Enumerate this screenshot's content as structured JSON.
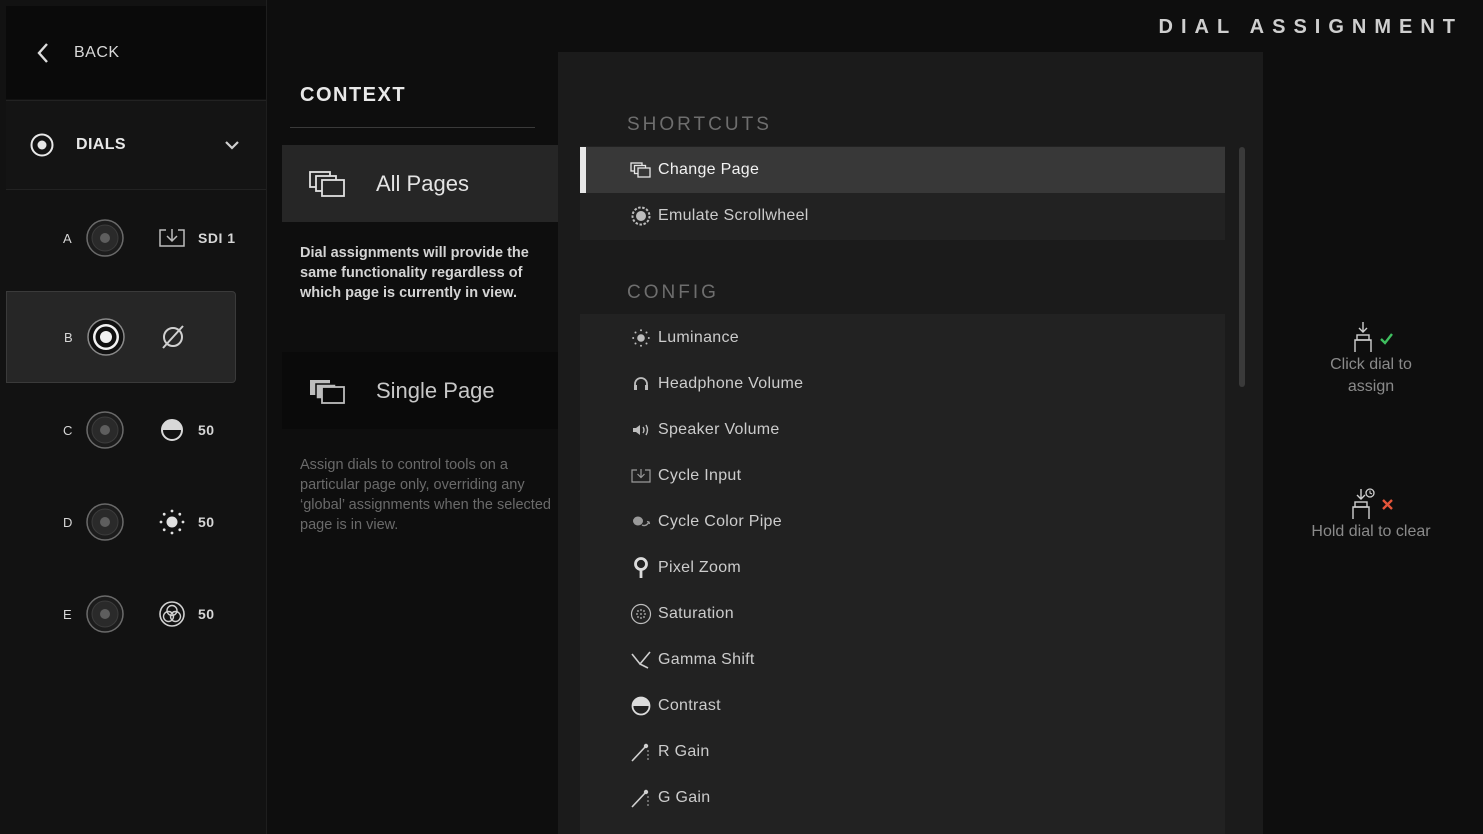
{
  "header": {
    "title": "DIAL ASSIGNMENT"
  },
  "sidebar": {
    "back_label": "BACK",
    "section_label": "DIALS",
    "dials": [
      {
        "letter": "A",
        "icon": "sdi-input-icon",
        "value": "SDI 1",
        "selected": false
      },
      {
        "letter": "B",
        "icon": "unassigned-icon",
        "value": "",
        "selected": true
      },
      {
        "letter": "C",
        "icon": "contrast-icon",
        "value": "50",
        "selected": false
      },
      {
        "letter": "D",
        "icon": "luminance-icon",
        "value": "50",
        "selected": false
      },
      {
        "letter": "E",
        "icon": "saturation-rgb-icon",
        "value": "50",
        "selected": false
      }
    ]
  },
  "context": {
    "heading": "CONTEXT",
    "all_pages": {
      "label": "All Pages",
      "description": "Dial assignments will provide the same functionality regardless of which page is currently in view."
    },
    "single_page": {
      "label": "Single Page",
      "description": "Assign dials to control tools on a particular page only, overriding any ‘global’ assignments when the selected page is in view."
    },
    "selected": "all_pages"
  },
  "shortcuts": {
    "heading": "SHORTCUTS",
    "items": [
      {
        "label": "Change Page",
        "icon": "pages-icon",
        "active": true
      },
      {
        "label": "Emulate Scrollwheel",
        "icon": "scrollwheel-icon",
        "active": false
      }
    ]
  },
  "config": {
    "heading": "CONFIG",
    "items": [
      {
        "label": "Luminance",
        "icon": "luminance-icon"
      },
      {
        "label": "Headphone Volume",
        "icon": "headphone-icon"
      },
      {
        "label": "Speaker Volume",
        "icon": "speaker-icon"
      },
      {
        "label": "Cycle Input",
        "icon": "input-icon"
      },
      {
        "label": "Cycle Color Pipe",
        "icon": "color-pipe-icon"
      },
      {
        "label": "Pixel Zoom",
        "icon": "pixel-zoom-icon"
      },
      {
        "label": "Saturation",
        "icon": "saturation-icon"
      },
      {
        "label": "Gamma Shift",
        "icon": "gamma-icon"
      },
      {
        "label": "Contrast",
        "icon": "contrast-icon"
      },
      {
        "label": "R Gain",
        "icon": "gain-icon"
      },
      {
        "label": "G Gain",
        "icon": "gain-icon"
      }
    ]
  },
  "hints": {
    "assign": "Click dial to assign",
    "clear": "Hold dial to clear",
    "assign_color": "#3fbf5f",
    "clear_color": "#e5553a"
  }
}
